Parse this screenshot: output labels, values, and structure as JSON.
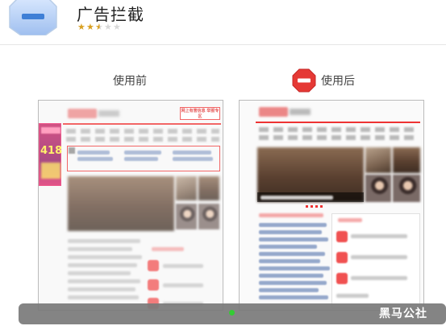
{
  "app": {
    "title": "广告拦截",
    "icon": "ad-block-octagon-icon",
    "rating_stars": 2.5,
    "rating_max": 5
  },
  "comparison": {
    "before_label": "使用前",
    "after_label": "使用后",
    "after_icon": "stop-sign-icon",
    "before_side_ad_text": "418",
    "before_top_ad_text": "网上有害信息 举报专区"
  },
  "watermark": "黑马公社",
  "colors": {
    "accent_red": "#e33333",
    "icon_blue": "#a9c8f5",
    "star_gold": "#d9a020",
    "bar_gray": "#7a7a7a"
  }
}
